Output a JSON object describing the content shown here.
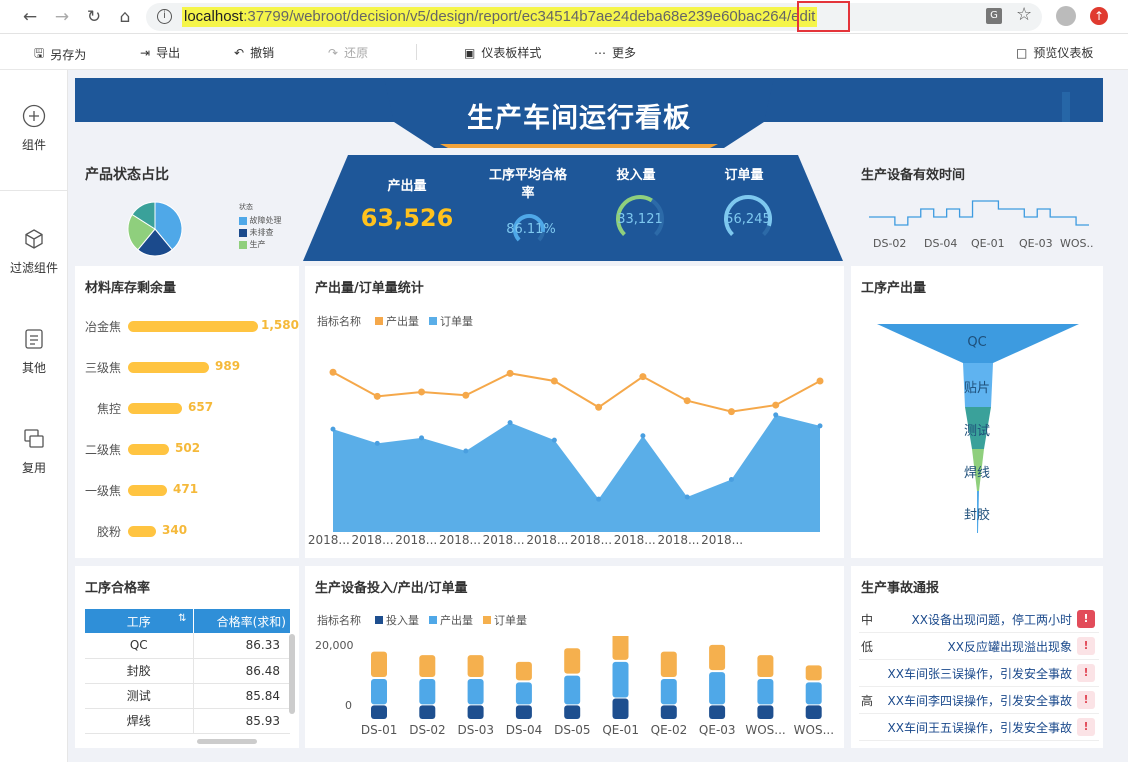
{
  "browser": {
    "url_host": "localhost",
    "url_rest": ":37799/webroot/decision/v5/design/report/ec34514b7ae24deba68e239e60bac264",
    "url_tail": "/edit"
  },
  "toolbar": {
    "save_as": "另存为",
    "export": "导出",
    "undo": "撤销",
    "redo": "还原",
    "style": "仪表板样式",
    "more": "更多",
    "preview": "预览仪表板"
  },
  "sidebar": {
    "components": "组件",
    "filter": "过滤组件",
    "other": "其他",
    "reuse": "复用"
  },
  "dashboard": {
    "title": "生产车间运行看板"
  },
  "kpi": {
    "output_label": "产出量",
    "output_value": "63,526",
    "pass_label_1": "工序平均合格",
    "pass_label_2": "率",
    "pass_value": "86.11%",
    "pass_fraction": 0.8611,
    "input_label": "投入量",
    "input_value": "33,121",
    "input_fraction": 0.62,
    "order_label": "订单量",
    "order_value": "56,245",
    "order_fraction": 0.9
  },
  "product_status": {
    "title": "产品状态占比",
    "legend_title": "状态",
    "legend": [
      "故障处理",
      "未排查",
      "生产"
    ],
    "colors": [
      "#4fa8e8",
      "#1b4a8c",
      "#8fcf7d",
      "#3aa19a"
    ],
    "values": [
      39,
      22,
      23,
      16
    ]
  },
  "equipment_time": {
    "title": "生产设备有效时间",
    "labels": [
      "DS-02",
      "DS-04",
      "QE-01",
      "QE-03",
      "WOS.."
    ],
    "values": [
      2,
      2,
      1,
      2,
      3,
      2,
      3,
      2,
      4,
      4,
      3,
      3,
      2,
      3,
      2,
      2,
      1
    ]
  },
  "materials": {
    "title": "材料库存剩余量",
    "items": [
      {
        "name": "冶金焦",
        "value": 1580,
        "label": "1,580"
      },
      {
        "name": "三级焦",
        "value": 989,
        "label": "989"
      },
      {
        "name": "焦控",
        "value": 657,
        "label": "657"
      },
      {
        "name": "二级焦",
        "value": 502,
        "label": "502"
      },
      {
        "name": "一级焦",
        "value": 471,
        "label": "471"
      },
      {
        "name": "胶粉",
        "value": 340,
        "label": "340"
      }
    ]
  },
  "output_order": {
    "title": "产出量/订单量统计",
    "legend_title": "指标名称",
    "legend_output": "产出量",
    "legend_order": "订单量",
    "x_labels": [
      "2018...",
      "2018...",
      "2018...",
      "2018...",
      "2018...",
      "2018...",
      "2018...",
      "2018...",
      "2018...",
      "2018..."
    ],
    "output": [
      7300,
      6200,
      6400,
      6250,
      7250,
      6900,
      5700,
      7100,
      6000,
      5500,
      5800,
      6900
    ],
    "order": [
      4700,
      4050,
      4300,
      3700,
      5000,
      4200,
      1500,
      4400,
      1600,
      2400,
      5350,
      4850
    ],
    "ylim": [
      0,
      8500
    ]
  },
  "process_output": {
    "title": "工序产出量",
    "stages": [
      "QC",
      "贴片",
      "测试",
      "焊线",
      "封胶"
    ],
    "colors": [
      "#3d9be0",
      "#5fb3f0",
      "#3aa19a",
      "#8fcf7d",
      "#4fa8e8"
    ]
  },
  "pass_rate": {
    "title": "工序合格率",
    "col_process": "工序",
    "col_rate": "合格率(求和)",
    "rows": [
      {
        "name": "QC",
        "rate": "86.33"
      },
      {
        "name": "封胶",
        "rate": "86.48"
      },
      {
        "name": "测试",
        "rate": "85.84"
      },
      {
        "name": "焊线",
        "rate": "85.93"
      }
    ]
  },
  "equipment_io": {
    "title": "生产设备投入/产出/订单量",
    "legend_title": "指标名称",
    "legend_input": "投入量",
    "legend_output": "产出量",
    "legend_order": "订单量",
    "y_ticks": [
      "20,000",
      "0"
    ],
    "categories": [
      "DS-01",
      "DS-02",
      "DS-03",
      "DS-04",
      "DS-05",
      "QE-01",
      "QE-02",
      "QE-03",
      "WOS...",
      "WOS..."
    ],
    "input": [
      2000,
      2000,
      2000,
      2000,
      2000,
      3000,
      2000,
      2000,
      2000,
      2000
    ],
    "output": [
      4000,
      4000,
      4000,
      3500,
      4500,
      5500,
      4000,
      5000,
      4000,
      3500
    ],
    "order": [
      4000,
      3500,
      3500,
      3000,
      4000,
      4500,
      4000,
      4000,
      3500,
      2500
    ]
  },
  "accidents": {
    "title": "生产事故通报",
    "items": [
      {
        "level": "中",
        "text": "XX设备出现问题，停工两小时",
        "color": "#e24c5a"
      },
      {
        "level": "低",
        "text": "XX反应罐出现溢出现象",
        "color": "#e24c5a"
      },
      {
        "level": "",
        "text": "XX车间张三误操作，引发安全事故",
        "color": "#e24c5a"
      },
      {
        "level": "高",
        "text": "XX车间李四误操作，引发安全事故",
        "color": "#e24c5a"
      },
      {
        "level": "",
        "text": "XX车间王五误操作，引发安全事故",
        "color": "#e24c5a"
      }
    ]
  }
}
